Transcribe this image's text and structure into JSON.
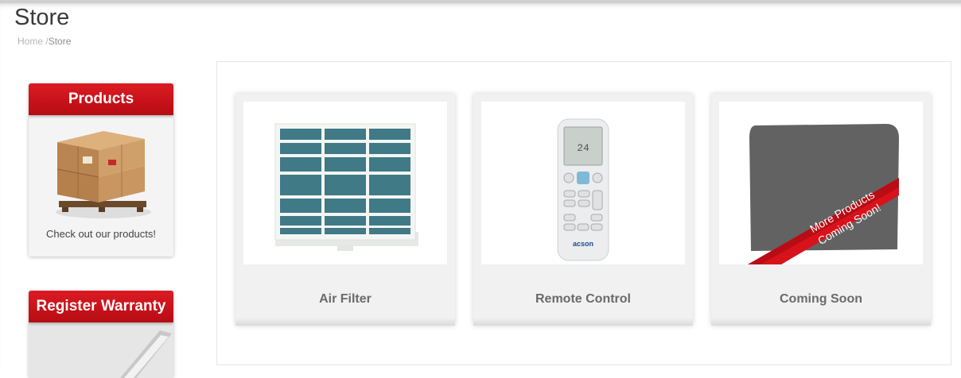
{
  "page": {
    "title": "Store"
  },
  "breadcrumb": {
    "home": "Home",
    "separator": "/",
    "current": "Store"
  },
  "sidebar": {
    "products": {
      "title": "Products",
      "caption": "Check out our products!"
    },
    "warranty": {
      "title": "Register Warranty"
    }
  },
  "products": [
    {
      "name": "Air Filter",
      "image": "air-filter"
    },
    {
      "name": "Remote Control",
      "image": "remote-control",
      "brand": "acson"
    },
    {
      "name": "Coming Soon",
      "image": "placeholder",
      "ribbon_line1": "More Products",
      "ribbon_line2": "Coming Soon!"
    }
  ],
  "colors": {
    "brand_red": "#d0161d",
    "text_dark": "#3a3a3a",
    "tile_bg": "#f1f1f1"
  }
}
